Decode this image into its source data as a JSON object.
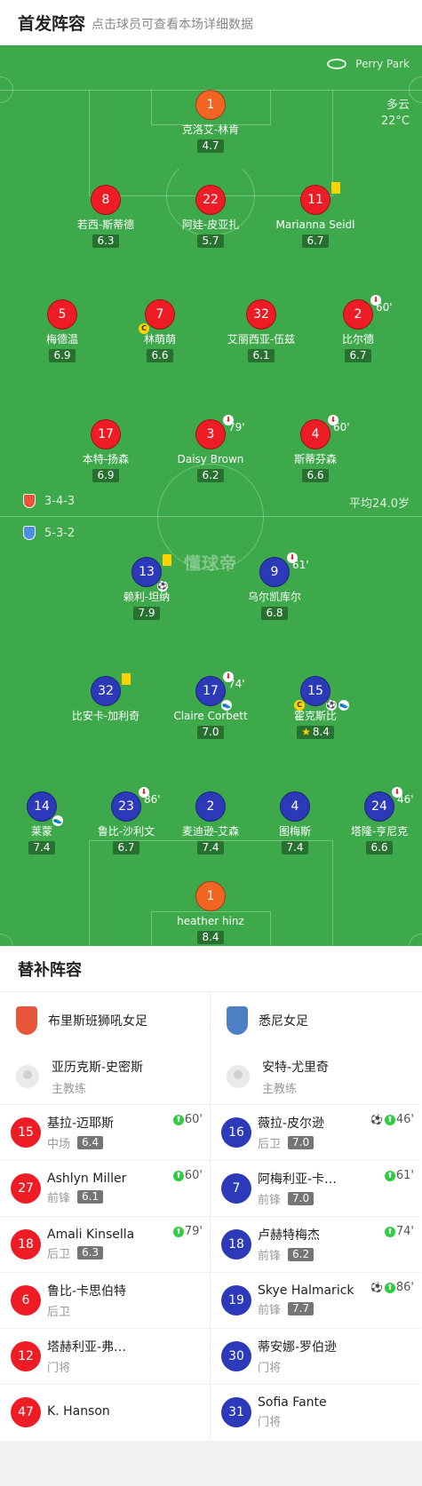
{
  "header": {
    "title": "首发阵容",
    "subtitle": "点击球员可查看本场详细数据"
  },
  "pitch": {
    "venue": "Perry Park",
    "weather": "多云",
    "temperature": "22°C",
    "brand": "懂球帝",
    "home_formation": "3-4-3",
    "away_formation": "5-3-2",
    "avg_age": "平均24.0岁"
  },
  "home_lineup": {
    "gk": {
      "number": "1",
      "name": "克洛艾-林肯",
      "rating": "4.7"
    },
    "def": [
      {
        "number": "8",
        "name": "若西-斯蒂德",
        "rating": "6.3"
      },
      {
        "number": "22",
        "name": "阿娃-皮亚扎",
        "rating": "5.7"
      },
      {
        "number": "11",
        "name": "Marianna Seidl",
        "rating": "6.7"
      }
    ],
    "mid": [
      {
        "number": "5",
        "name": "梅德温",
        "rating": "6.9"
      },
      {
        "number": "7",
        "name": "林萌萌",
        "rating": "6.6"
      },
      {
        "number": "32",
        "name": "艾丽西亚-伍兹",
        "rating": "6.1"
      },
      {
        "number": "2",
        "name": "比尔德",
        "rating": "6.7",
        "sub_minute": "60'"
      }
    ],
    "att": [
      {
        "number": "17",
        "name": "本特-扬森",
        "rating": "6.9"
      },
      {
        "number": "3",
        "name": "Daisy Brown",
        "rating": "6.2",
        "sub_minute": "79'"
      },
      {
        "number": "4",
        "name": "斯蒂芬森",
        "rating": "6.6",
        "sub_minute": "60'"
      }
    ]
  },
  "away_lineup": {
    "fwd": [
      {
        "number": "13",
        "name": "赖利-坦纳",
        "rating": "7.9"
      },
      {
        "number": "9",
        "name": "乌尔凯库尔",
        "rating": "6.8",
        "sub_minute": "61'"
      }
    ],
    "mid": [
      {
        "number": "32",
        "name": "比安卡-加利奇",
        "rating": ""
      },
      {
        "number": "17",
        "name": "Claire Corbett",
        "rating": "7.0",
        "sub_minute": "74'"
      },
      {
        "number": "15",
        "name": "霍克斯比",
        "rating": "8.4"
      }
    ],
    "def": [
      {
        "number": "14",
        "name": "莱蒙",
        "rating": "7.4"
      },
      {
        "number": "23",
        "name": "鲁比-沙利文",
        "rating": "6.7",
        "sub_minute": "86'"
      },
      {
        "number": "2",
        "name": "麦迪逊-艾森",
        "rating": "7.4"
      },
      {
        "number": "4",
        "name": "图梅斯",
        "rating": "7.4"
      },
      {
        "number": "24",
        "name": "塔隆-亨尼克",
        "rating": "6.6",
        "sub_minute": "46'"
      }
    ],
    "gk": {
      "number": "1",
      "name": "heather hinz",
      "rating": "8.4"
    }
  },
  "subs": {
    "title": "替补阵容",
    "home": {
      "team": "布里斯班狮吼女足",
      "coach_name": "亚历克斯-史密斯",
      "coach_role": "主教练",
      "players": [
        {
          "number": "15",
          "name": "基拉-迈耶斯",
          "pos": "中场",
          "rating": "6.4",
          "in": "60'"
        },
        {
          "number": "27",
          "name": "Ashlyn Miller",
          "pos": "前锋",
          "rating": "6.1",
          "in": "60'"
        },
        {
          "number": "18",
          "name": "Amali Kinsella",
          "pos": "后卫",
          "rating": "6.3",
          "in": "79'"
        },
        {
          "number": "6",
          "name": "鲁比-卡思伯特",
          "pos": "后卫",
          "rating": "",
          "in": ""
        },
        {
          "number": "12",
          "name": "塔赫利亚-弗…",
          "pos": "门将",
          "rating": "",
          "in": ""
        },
        {
          "number": "47",
          "name": "K. Hanson",
          "pos": "",
          "rating": "",
          "in": ""
        }
      ]
    },
    "away": {
      "team": "悉尼女足",
      "coach_name": "安特-尤里奇",
      "coach_role": "主教练",
      "players": [
        {
          "number": "16",
          "name": "薇拉-皮尔逊",
          "pos": "后卫",
          "rating": "7.0",
          "in": "46'"
        },
        {
          "number": "7",
          "name": "阿梅利亚-卡…",
          "pos": "前锋",
          "rating": "7.0",
          "in": "61'"
        },
        {
          "number": "18",
          "name": "卢赫特梅杰",
          "pos": "前锋",
          "rating": "6.2",
          "in": "74'"
        },
        {
          "number": "19",
          "name": "Skye Halmarick",
          "pos": "前锋",
          "rating": "7.7",
          "in": "86'"
        },
        {
          "number": "30",
          "name": "蒂安娜-罗伯逊",
          "pos": "门将",
          "rating": "",
          "in": ""
        },
        {
          "number": "31",
          "name": "Sofia Fante",
          "pos": "门将",
          "rating": "",
          "in": ""
        }
      ]
    }
  }
}
